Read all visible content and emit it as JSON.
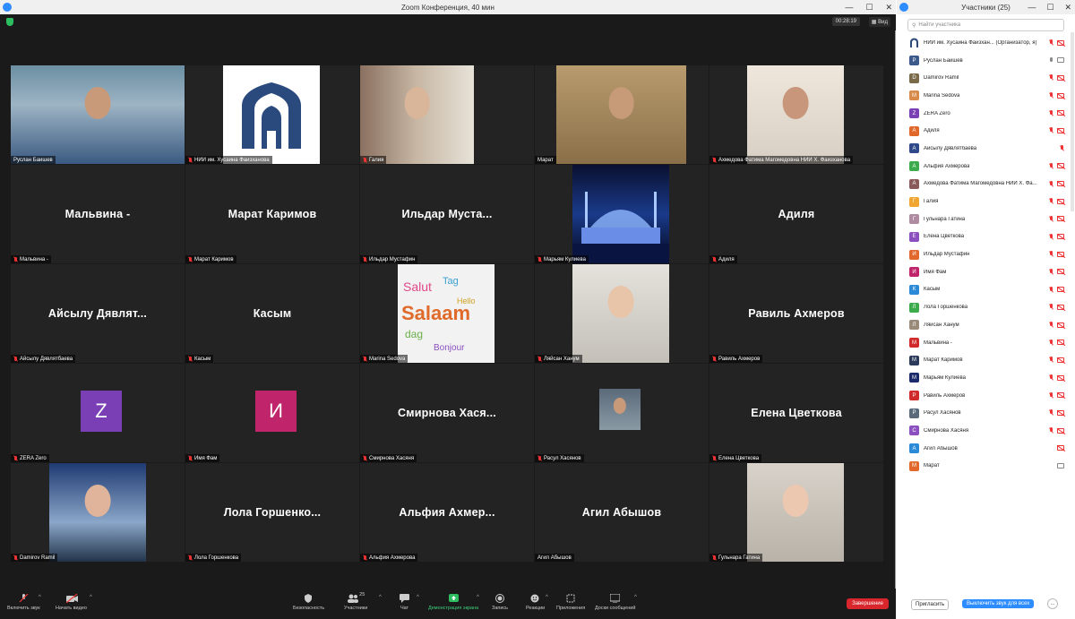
{
  "window": {
    "title": "Zoom Конференция, 40 мин",
    "timer": "00:28:19",
    "view_label": "Вид"
  },
  "tiles": [
    {
      "id": "t1",
      "label": "Руслан Баишев",
      "muted": false,
      "type": "photo",
      "active": true
    },
    {
      "id": "t2",
      "label": "НИИ им. Хусаина Фаизханова",
      "muted": true,
      "type": "logo"
    },
    {
      "id": "t3",
      "label": "Галия",
      "muted": true,
      "type": "photo"
    },
    {
      "id": "t4",
      "label": "Марат",
      "muted": false,
      "type": "photo"
    },
    {
      "id": "t5",
      "label": "Ахмедова Фатима Магомедовна НИИ Х. Фаизханова",
      "muted": true,
      "type": "photo"
    },
    {
      "id": "t6",
      "label": "Мальвина -",
      "big": "Мальвина -",
      "muted": true,
      "type": "name"
    },
    {
      "id": "t7",
      "label": "Марат Каримов",
      "big": "Марат Каримов",
      "muted": true,
      "type": "name"
    },
    {
      "id": "t8",
      "label": "Ильдар Мустафин",
      "big": "Ильдар Муста...",
      "muted": true,
      "type": "name"
    },
    {
      "id": "t9",
      "label": "Марьям Кулиева",
      "muted": true,
      "type": "photo"
    },
    {
      "id": "t10",
      "label": "Адиля",
      "big": "Адиля",
      "muted": true,
      "type": "name"
    },
    {
      "id": "t11",
      "label": "Айсылу Дявлятбаева",
      "big": "Айсылу Дявлят...",
      "muted": true,
      "type": "name"
    },
    {
      "id": "t12",
      "label": "Касым",
      "big": "Касым",
      "muted": true,
      "type": "name"
    },
    {
      "id": "t13",
      "label": "Marina Sedova",
      "muted": true,
      "type": "photo"
    },
    {
      "id": "t14",
      "label": "Ляйсан Ханум",
      "muted": true,
      "type": "photo"
    },
    {
      "id": "t15",
      "label": "Равиль Ахмеров",
      "big": "Равиль Ахмеров",
      "muted": true,
      "type": "name"
    },
    {
      "id": "t16",
      "label": "ZERA Zero",
      "letter": "Z",
      "muted": true,
      "type": "avatar"
    },
    {
      "id": "t17",
      "label": "Имя Фам",
      "letter": "И",
      "muted": true,
      "type": "avatar"
    },
    {
      "id": "t18",
      "label": "Смирнова Хасяня",
      "big": "Смирнова Хася...",
      "muted": true,
      "type": "name"
    },
    {
      "id": "t19",
      "label": "Расул Хасянов",
      "muted": true,
      "type": "photo"
    },
    {
      "id": "t20",
      "label": "Елена Цветкова",
      "big": "Елена Цветкова",
      "muted": true,
      "type": "name"
    },
    {
      "id": "t21",
      "label": "Damirov Ramil",
      "muted": true,
      "type": "photo"
    },
    {
      "id": "t22",
      "label": "Лола Горшенкова",
      "big": "Лола Горшенко...",
      "muted": true,
      "type": "name"
    },
    {
      "id": "t23",
      "label": "Альфия Ахмерова",
      "big": "Альфия Ахмер...",
      "muted": true,
      "type": "name"
    },
    {
      "id": "t24",
      "label": "Агил Абышов",
      "big": "Агил Абышов",
      "muted": false,
      "type": "name"
    },
    {
      "id": "t25",
      "label": "Гульнара Гатина",
      "muted": true,
      "type": "photo"
    }
  ],
  "toolbar": {
    "mute": "Включить звук",
    "video": "Начать видео",
    "security": "Безопасность",
    "participants": "Участники",
    "participants_count": "25",
    "chat": "Чат",
    "share": "Демонстрация экрана",
    "record": "Запись",
    "reactions": "Реакции",
    "apps": "Приложения",
    "whiteboards": "Доски сообщений",
    "end": "Завершение"
  },
  "panel": {
    "title": "Участники (25)",
    "search_placeholder": "Найти участника",
    "invite": "Пригласить",
    "mute_all": "Выключить звук для всех",
    "more": "..."
  },
  "participants": [
    {
      "name": "НИИ им. Хусаина Фаизхан... (Организатор, я)",
      "avatar": "logo",
      "color": "#2c4a7a",
      "mic": "off",
      "cam": "off"
    },
    {
      "name": "Руслан Баишев",
      "letter": "Р",
      "color": "#3b5a8a",
      "mic": "on",
      "cam": "on"
    },
    {
      "name": "Damirov Ramil",
      "letter": "D",
      "color": "#7a6a4a",
      "mic": "off",
      "cam": "off"
    },
    {
      "name": "Marina Sedova",
      "letter": "M",
      "color": "#d88a4a",
      "mic": "off",
      "cam": "off"
    },
    {
      "name": "ZERA Zero",
      "letter": "Z",
      "color": "#7b3fb5",
      "mic": "off",
      "cam": "off"
    },
    {
      "name": "Адиля",
      "letter": "А",
      "color": "#e2672a",
      "mic": "off",
      "cam": "off"
    },
    {
      "name": "Айсылу Дявлятбаева",
      "letter": "А",
      "color": "#2f4a8a",
      "mic": "off",
      "cam": "none"
    },
    {
      "name": "Альфия Ахмерова",
      "letter": "А",
      "color": "#3cab4b",
      "mic": "off",
      "cam": "off"
    },
    {
      "name": "Ахмедова Фатима Магомедовна НИИ Х. Фа...",
      "letter": "А",
      "color": "#8a5a5a",
      "mic": "off",
      "cam": "off"
    },
    {
      "name": "Галия",
      "letter": "Г",
      "color": "#f0a630",
      "mic": "off",
      "cam": "off"
    },
    {
      "name": "Гульнара Гатина",
      "letter": "Г",
      "color": "#b08aa0",
      "mic": "off",
      "cam": "off"
    },
    {
      "name": "Елена Цветкова",
      "letter": "Е",
      "color": "#8b4fc0",
      "mic": "off",
      "cam": "off"
    },
    {
      "name": "Ильдар Мустафин",
      "letter": "И",
      "color": "#e2672a",
      "mic": "off",
      "cam": "off"
    },
    {
      "name": "Имя Фам",
      "letter": "И",
      "color": "#c0246a",
      "mic": "off",
      "cam": "off"
    },
    {
      "name": "Касым",
      "letter": "К",
      "color": "#2b8ad8",
      "mic": "off",
      "cam": "off"
    },
    {
      "name": "Лола Горшенкова",
      "letter": "Л",
      "color": "#3cab4b",
      "mic": "off",
      "cam": "off"
    },
    {
      "name": "Ляйсан Ханум",
      "letter": "Л",
      "color": "#9a8a7a",
      "mic": "off",
      "cam": "off"
    },
    {
      "name": "Мальвина -",
      "letter": "М",
      "color": "#d02a2a",
      "mic": "off",
      "cam": "off"
    },
    {
      "name": "Марат Каримов",
      "letter": "М",
      "color": "#2b3a5a",
      "mic": "off",
      "cam": "off"
    },
    {
      "name": "Марьям Кулиева",
      "letter": "М",
      "color": "#1a2a6a",
      "mic": "off",
      "cam": "off"
    },
    {
      "name": "Равиль Ахмеров",
      "letter": "Р",
      "color": "#d02a2a",
      "mic": "off",
      "cam": "off"
    },
    {
      "name": "Расул Хасянов",
      "letter": "Р",
      "color": "#5a6a7a",
      "mic": "off",
      "cam": "off"
    },
    {
      "name": "Смирнова Хасяня",
      "letter": "С",
      "color": "#8b4fc0",
      "mic": "off",
      "cam": "off"
    },
    {
      "name": "Агил Абышов",
      "letter": "А",
      "color": "#2b8ad8",
      "mic": "none",
      "cam": "off"
    },
    {
      "name": "Марат",
      "letter": "М",
      "color": "#e2672a",
      "mic": "none",
      "cam": "on"
    }
  ]
}
